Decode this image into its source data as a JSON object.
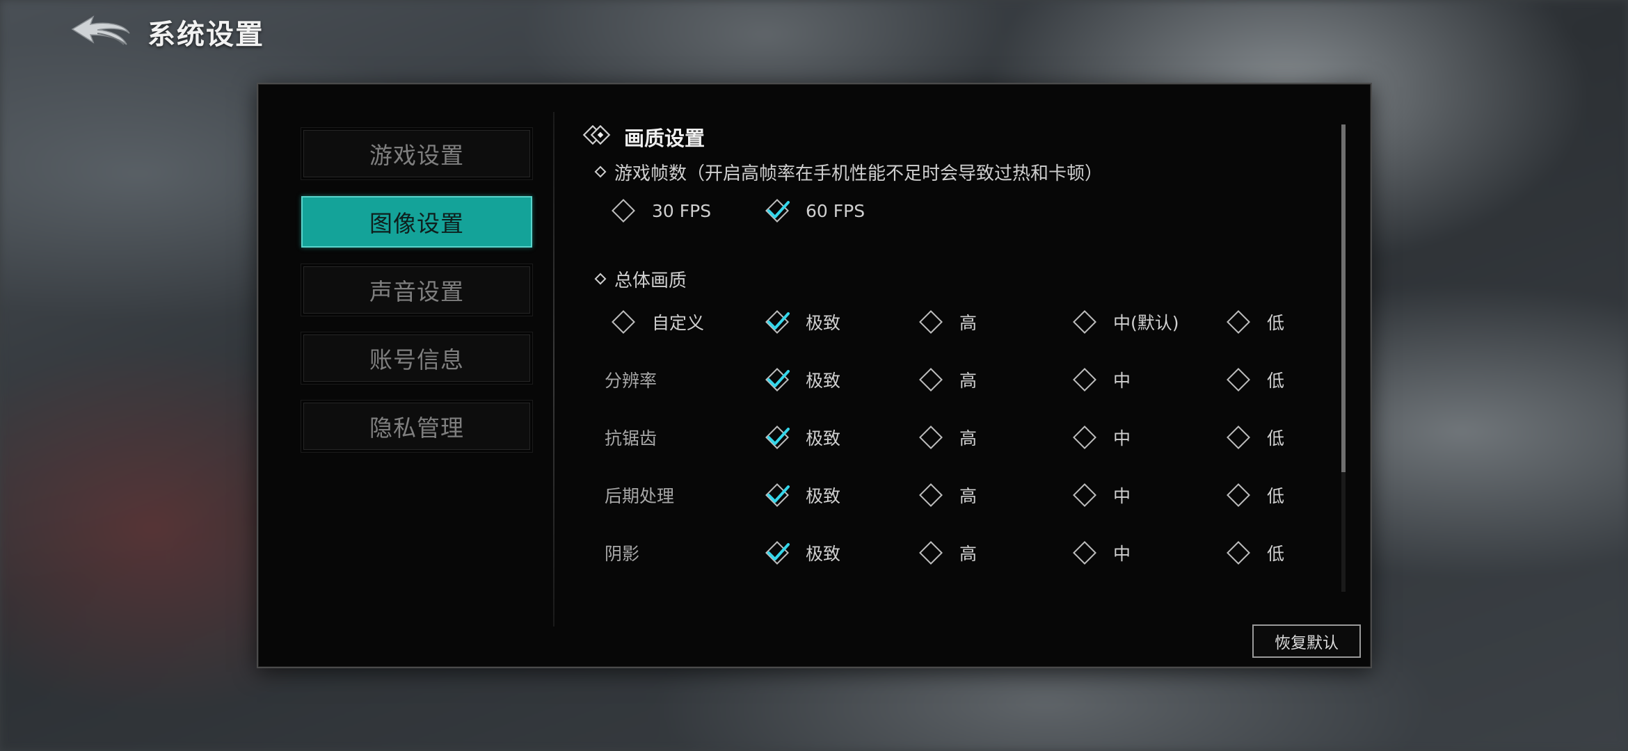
{
  "header": {
    "title": "系统设置"
  },
  "sidebar": {
    "tabs": [
      {
        "label": "游戏设置",
        "active": false
      },
      {
        "label": "图像设置",
        "active": true
      },
      {
        "label": "声音设置",
        "active": false
      },
      {
        "label": "账号信息",
        "active": false
      },
      {
        "label": "隐私管理",
        "active": false
      }
    ]
  },
  "content": {
    "section_title": "画质设置",
    "fps": {
      "title": "游戏帧数（开启高帧率在手机性能不足时会导致过热和卡顿）",
      "options": [
        {
          "label": "30 FPS",
          "selected": false
        },
        {
          "label": "60 FPS",
          "selected": true
        }
      ]
    },
    "quality": {
      "title": "总体画质",
      "overall_options": [
        {
          "label": "自定义",
          "selected": false
        },
        {
          "label": "极致",
          "selected": true
        },
        {
          "label": "高",
          "selected": false
        },
        {
          "label": "中(默认)",
          "selected": false
        },
        {
          "label": "低",
          "selected": false
        }
      ],
      "rows": [
        {
          "label": "分辨率",
          "options": [
            "极致",
            "高",
            "中",
            "低"
          ],
          "selected_index": 0
        },
        {
          "label": "抗锯齿",
          "options": [
            "极致",
            "高",
            "中",
            "低"
          ],
          "selected_index": 0
        },
        {
          "label": "后期处理",
          "options": [
            "极致",
            "高",
            "中",
            "低"
          ],
          "selected_index": 0
        },
        {
          "label": "阴影",
          "options": [
            "极致",
            "高",
            "中",
            "低"
          ],
          "selected_index": 0
        }
      ]
    },
    "restore_label": "恢复默认"
  },
  "colors": {
    "accent": "#14a399",
    "check": "#35d6ea",
    "panel_bg": "#070707"
  },
  "icons": {
    "back": "back-arrow-icon",
    "section": "diamond-section-icon",
    "checked": "checked-diamond-icon",
    "unchecked": "diamond-icon"
  }
}
